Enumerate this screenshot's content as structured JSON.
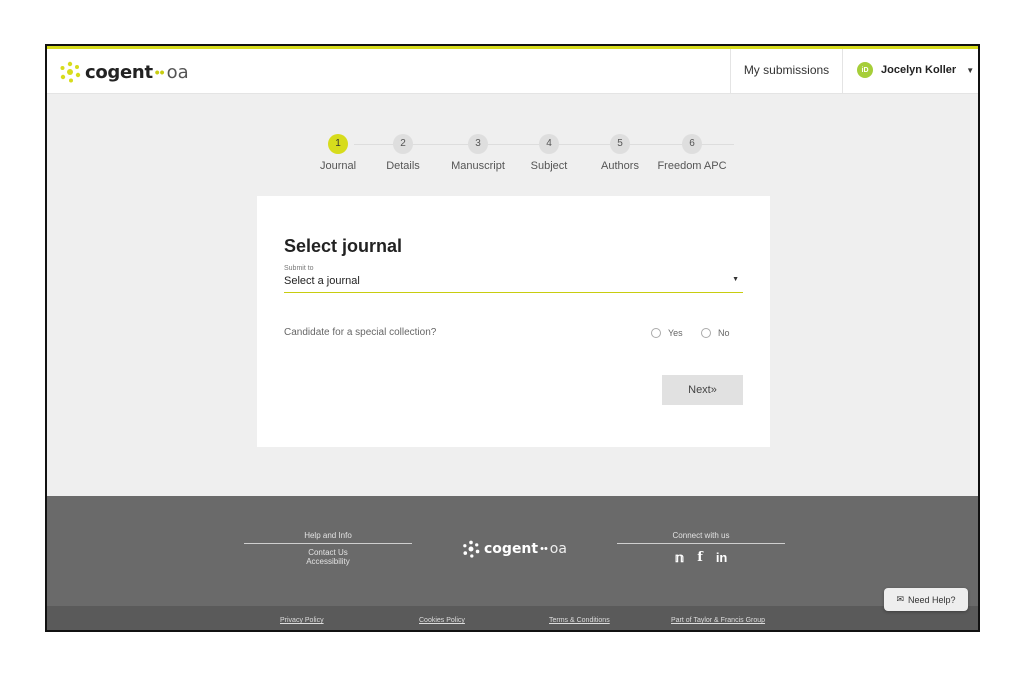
{
  "brand": {
    "name": "cogent",
    "suffix": "oa",
    "dots": "••",
    "accent": "#d7dc1c"
  },
  "header": {
    "my_submissions": "My submissions",
    "user_name": "Jocelyn Koller",
    "orcid_label": "iD"
  },
  "stepper": {
    "steps": [
      {
        "num": "1",
        "label": "Journal"
      },
      {
        "num": "2",
        "label": "Details"
      },
      {
        "num": "3",
        "label": "Manuscript"
      },
      {
        "num": "4",
        "label": "Subject"
      },
      {
        "num": "5",
        "label": "Authors"
      },
      {
        "num": "6",
        "label": "Freedom APC"
      }
    ],
    "active_index": 0
  },
  "form": {
    "title": "Select journal",
    "submit_label": "Submit to",
    "select_value": "Select a journal",
    "question": "Candidate for a special collection?",
    "yes_label": "Yes",
    "no_label": "No",
    "next_label": "Next»"
  },
  "footer": {
    "help_title": "Help and Info",
    "contact": "Contact Us",
    "accessibility": "Accessibility",
    "connect_title": "Connect with us",
    "social": [
      "twitter-icon",
      "facebook-icon",
      "linkedin-icon"
    ]
  },
  "legal": {
    "privacy": "Privacy Policy",
    "cookies": "Cookies Policy",
    "terms": "Terms & Conditions",
    "group": "Part of Taylor & Francis Group"
  },
  "help_button": {
    "label": "Need Help?"
  }
}
